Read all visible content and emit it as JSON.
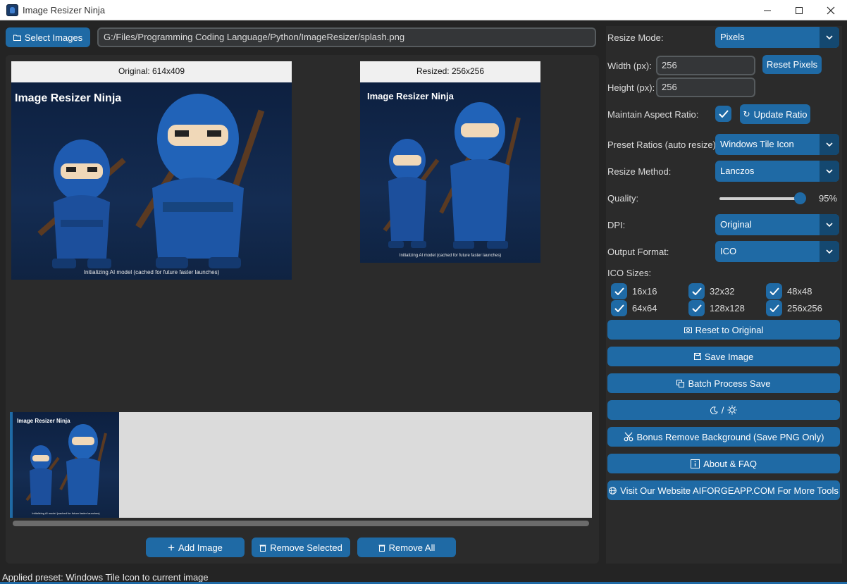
{
  "window": {
    "title": "Image Resizer Ninja"
  },
  "toolbar": {
    "select_images_label": "Select Images",
    "path_value": "G:/Files/Programming Coding Language/Python/ImageResizer/splash.png"
  },
  "preview": {
    "original_label": "Original: 614x409",
    "resized_label": "Resized: 256x256",
    "image_logo_text": "Image Resizer Ninja",
    "image_caption": "Initializing AI model (cached for future faster launches)"
  },
  "thumbnails": [
    {
      "logo_text": "Image Resizer Ninja",
      "caption": "Initializing AI model (cached for future faster launches)"
    }
  ],
  "list_buttons": {
    "add_image": "Add Image",
    "remove_selected": "Remove Selected",
    "remove_all": "Remove All"
  },
  "settings": {
    "resize_mode_label": "Resize Mode:",
    "resize_mode_value": "Pixels",
    "width_label": "Width (px):",
    "width_value": "256",
    "height_label": "Height (px):",
    "height_value": "256",
    "reset_pixels_label": "Reset Pixels",
    "aspect_label": "Maintain Aspect Ratio:",
    "aspect_checked": true,
    "update_ratio_label": "Update Ratio",
    "preset_label": "Preset Ratios (auto resize):",
    "preset_value": "Windows Tile Icon",
    "method_label": "Resize Method:",
    "method_value": "Lanczos",
    "quality_label": "Quality:",
    "quality_value": 95,
    "quality_text": "95%",
    "dpi_label": "DPI:",
    "dpi_value": "Original",
    "format_label": "Output Format:",
    "format_value": "ICO",
    "ico_sizes_label": "ICO Sizes:",
    "ico_sizes": [
      {
        "label": "16x16",
        "checked": true
      },
      {
        "label": "32x32",
        "checked": true
      },
      {
        "label": "48x48",
        "checked": true
      },
      {
        "label": "64x64",
        "checked": true
      },
      {
        "label": "128x128",
        "checked": true
      },
      {
        "label": "256x256",
        "checked": true
      }
    ]
  },
  "actions": {
    "reset_original": "Reset to Original",
    "save_image": "Save Image",
    "batch_save": "Batch Process Save",
    "theme_toggle": "/",
    "remove_bg": "Bonus Remove Background (Save PNG Only)",
    "about": "About & FAQ",
    "website": "Visit Our Website AIFORGEAPP.COM For More Tools"
  },
  "status": {
    "text": "Applied preset: Windows Tile Icon to current image"
  },
  "colors": {
    "accent": "#1f6aa5",
    "accent_dark": "#144870",
    "bg": "#242424",
    "panel": "#2b2b2b"
  }
}
